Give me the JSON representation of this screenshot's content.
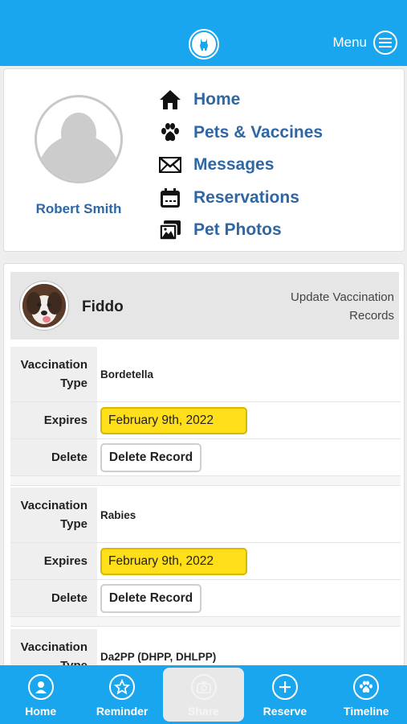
{
  "header": {
    "logo_icon": "dog-logo-icon",
    "menu_label": "Menu",
    "menu_icon": "hamburger-icon"
  },
  "profile": {
    "name": "Robert Smith",
    "avatar_icon": "user-silhouette-icon"
  },
  "nav": {
    "items": [
      {
        "label": "Home",
        "icon": "home-icon"
      },
      {
        "label": "Pets & Vaccines",
        "icon": "paw-icon"
      },
      {
        "label": "Messages",
        "icon": "envelope-icon"
      },
      {
        "label": "Reservations",
        "icon": "calendar-icon"
      },
      {
        "label": "Pet Photos",
        "icon": "photos-icon"
      }
    ]
  },
  "pet": {
    "name": "Fiddo",
    "update_link": "Update Vaccination Records"
  },
  "labels": {
    "type": "Vaccination Type",
    "expires": "Expires",
    "delete": "Delete",
    "delete_button": "Delete Record"
  },
  "vaccinations": [
    {
      "type": "Bordetella",
      "expires": "February 9th, 2022"
    },
    {
      "type": "Rabies",
      "expires": "February 9th, 2022"
    },
    {
      "type": "Da2PP (DHPP, DHLPP)"
    }
  ],
  "bottom_nav": {
    "tabs": [
      {
        "label": "Home",
        "icon": "user-circle-icon"
      },
      {
        "label": "Reminder",
        "icon": "star-icon"
      },
      {
        "label": "Share",
        "icon": "camera-icon",
        "active": true
      },
      {
        "label": "Reserve",
        "icon": "plus-icon"
      },
      {
        "label": "Timeline",
        "icon": "paw-icon"
      }
    ]
  },
  "colors": {
    "brand": "#1aa6ee",
    "link": "#2e67a3",
    "date_highlight": "#ffdf1a"
  }
}
